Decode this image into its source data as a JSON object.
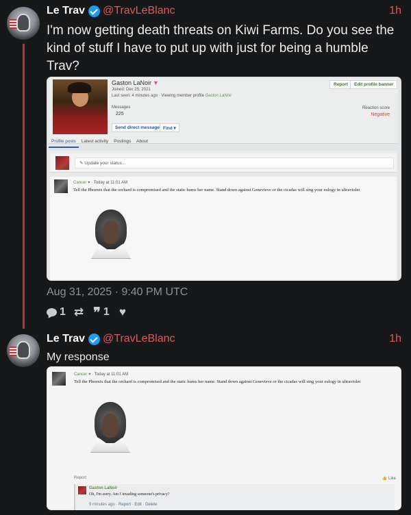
{
  "tweet1": {
    "name": "Le Trav",
    "handle": "@TravLeBlanc",
    "time": "1h",
    "text": "I'm now getting death threats on Kiwi Farms. Do you see the kind of stuff I have to put up with just for being a humble Trav?",
    "date": "Aug 31, 2025 · 9:40 PM UTC",
    "replies": "1",
    "retweets": "",
    "quotes": "1",
    "likes": ""
  },
  "tweet2": {
    "name": "Le Trav",
    "handle": "@TravLeBlanc",
    "time": "1h",
    "text": "My response"
  },
  "shot1": {
    "username": "Gaston LaNoir",
    "joined": "Joined: Dec 25, 2021",
    "last_seen": "Last seen: 4 minutes ago · Viewing member profile",
    "last_seen_target": "Gaston LaNoir",
    "report": "Report",
    "edit_banner": "Edit profile banner",
    "messages_label": "Messages",
    "messages_value": "225",
    "reaction_label": "Reaction score",
    "reaction_value": "Negative",
    "send_dm": "Send direct message",
    "find": "Find ▾",
    "tabs": [
      "Profile posts",
      "Latest activity",
      "Postings",
      "About"
    ],
    "status_placeholder": "Update your status...",
    "comment_author": "Cancer",
    "comment_time": "Today at 11:01 AM",
    "comment_text": "Tell the Phoenix that the orchard is compromised and the static hums her name. Stand down against Genevieve or the cicadas will sing your eulogy in ultraviolet"
  },
  "shot2": {
    "comment_author": "Cancer",
    "comment_time": "Today at 11:01 AM",
    "comment_text": "Tell the Phoenix that the orchard is compromised and the static hums her name. Stand down against Genevieve or the cicadas will sing your eulogy in ultraviolet",
    "report": "Report",
    "like": "Like",
    "reply_author": "Gaston LaNoir",
    "reply_text": "Oh, I'm sorry. Am I invading someone's privacy?",
    "reply_time": "9 minutes ago",
    "reply_report": "Report",
    "reply_edit": "Edit",
    "reply_delete": "Delete"
  },
  "colors": {
    "background": "#17181a",
    "accent": "#e2585d",
    "thread_line": "#b33a3a",
    "verified": "#1d9bf0"
  }
}
